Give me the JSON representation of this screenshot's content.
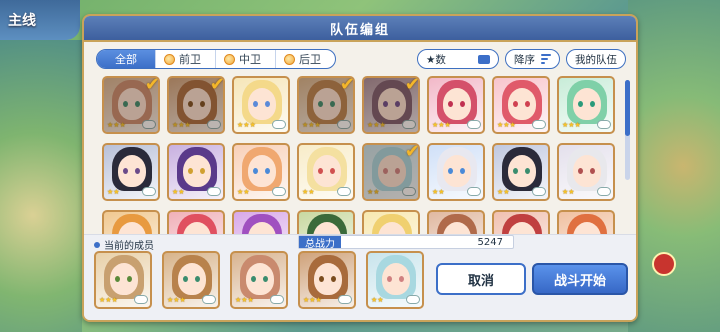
{
  "window": {
    "title": "队伍编组",
    "bg_title": "主线"
  },
  "filters": {
    "tabs": [
      {
        "label": "全部",
        "active": true,
        "icon": ""
      },
      {
        "label": "前卫",
        "active": false,
        "icon": "position-icon"
      },
      {
        "label": "中卫",
        "active": false,
        "icon": "position-icon"
      },
      {
        "label": "后卫",
        "active": false,
        "icon": "position-icon"
      }
    ],
    "sort_field": "★数",
    "sort_order": "降序",
    "my_team": "我的队伍"
  },
  "roster": [
    {
      "stars": "★★★",
      "selected": true,
      "hair": "#c98a6e",
      "bg": "#d8b38f",
      "eye": "#3a8c6e"
    },
    {
      "stars": "★★★",
      "selected": true,
      "hair": "#a86b3c",
      "bg": "#cfa27a",
      "eye": "#7a4c1e"
    },
    {
      "stars": "★★★",
      "selected": false,
      "hair": "#f4d98a",
      "bg": "#f6e6b8",
      "eye": "#5b8ad8"
    },
    {
      "stars": "★★★",
      "selected": true,
      "hair": "#b8824c",
      "bg": "#d7b38a",
      "eye": "#3a8c6e"
    },
    {
      "stars": "★★★",
      "selected": true,
      "hair": "#7a5a6e",
      "bg": "#a88c9a",
      "eye": "#6a4a8a"
    },
    {
      "stars": "★★★",
      "selected": false,
      "hair": "#d4506a",
      "bg": "#f2b8c8",
      "eye": "#c03050"
    },
    {
      "stars": "★★★",
      "selected": false,
      "hair": "#e05a6a",
      "bg": "#f8c4cc",
      "eye": "#d04050"
    },
    {
      "stars": "★★★",
      "selected": false,
      "hair": "#7fd0a8",
      "bg": "#c8ecd8",
      "eye": "#2a9a7a"
    },
    {
      "stars": "★★",
      "selected": false,
      "hair": "#2a2a3a",
      "bg": "#b8c0d8",
      "eye": "#6a4a8a"
    },
    {
      "stars": "★★",
      "selected": false,
      "hair": "#5a3a8a",
      "bg": "#c8b0e0",
      "eye": "#d0a030"
    },
    {
      "stars": "★★",
      "selected": false,
      "hair": "#f0a870",
      "bg": "#f8d0b8",
      "eye": "#4a8ad8"
    },
    {
      "stars": "★★",
      "selected": false,
      "hair": "#f4e0a0",
      "bg": "#f8ecc8",
      "eye": "#d05050"
    },
    {
      "stars": "★★",
      "selected": true,
      "hair": "#a8d8e0",
      "bg": "#c8e4ec",
      "eye": "#d08080"
    },
    {
      "stars": "★★",
      "selected": false,
      "hair": "#e8e8f0",
      "bg": "#d0e0f8",
      "eye": "#4a8ad8"
    },
    {
      "stars": "★★",
      "selected": false,
      "hair": "#2a2a3a",
      "bg": "#c0c8e0",
      "eye": "#3a8c6e"
    },
    {
      "stars": "★★",
      "selected": false,
      "hair": "#e8e8ec",
      "bg": "#e4e0ec",
      "eye": "#b05050"
    },
    {
      "stars": "",
      "selected": false,
      "hair": "#e89a40",
      "bg": "#f0c890",
      "eye": "#5a3a2a"
    },
    {
      "stars": "",
      "selected": false,
      "hair": "#e05060",
      "bg": "#f0b0b8",
      "eye": "#5a3a2a"
    },
    {
      "stars": "",
      "selected": false,
      "hair": "#a050c0",
      "bg": "#d8a8e8",
      "eye": "#5a3a2a"
    },
    {
      "stars": "",
      "selected": false,
      "hair": "#3a6a3a",
      "bg": "#c8d8a0",
      "eye": "#5a3a2a"
    },
    {
      "stars": "",
      "selected": false,
      "hair": "#f0d070",
      "bg": "#f8e8b0",
      "eye": "#5a3a2a"
    },
    {
      "stars": "",
      "selected": false,
      "hair": "#b06a4a",
      "bg": "#e0b8a0",
      "eye": "#5a3a2a"
    },
    {
      "stars": "",
      "selected": false,
      "hair": "#c04040",
      "bg": "#f0c0b0",
      "eye": "#5a3a2a"
    },
    {
      "stars": "",
      "selected": false,
      "hair": "#e07040",
      "bg": "#f0c0a0",
      "eye": "#5a3a2a"
    }
  ],
  "current": {
    "label": "当前的成员",
    "power_label": "总战力",
    "power_value": "5247",
    "members": [
      {
        "stars": "★★★",
        "hair": "#c8a070",
        "bg": "#e8d0a8",
        "eye": "#5a8a3a"
      },
      {
        "stars": "★★★",
        "hair": "#b8824c",
        "bg": "#d7b38a",
        "eye": "#3a8c6e"
      },
      {
        "stars": "★★★",
        "hair": "#c98a6e",
        "bg": "#d8b38f",
        "eye": "#3a8c6e"
      },
      {
        "stars": "★★★",
        "hair": "#a86b3c",
        "bg": "#cfa27a",
        "eye": "#7a4c1e"
      },
      {
        "stars": "★★",
        "hair": "#a8d8e0",
        "bg": "#c8e4ec",
        "eye": "#d08080"
      }
    ]
  },
  "actions": {
    "cancel": "取消",
    "start": "战斗开始"
  }
}
